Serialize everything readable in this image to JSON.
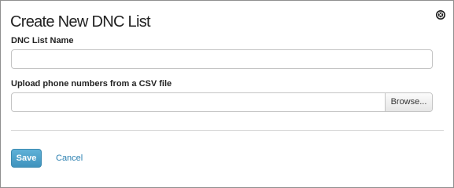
{
  "dialog": {
    "title": "Create New DNC List",
    "close_icon": "close-circle-icon"
  },
  "form": {
    "name_label": "DNC List Name",
    "name_value": "",
    "upload_label": "Upload phone numbers from a CSV file",
    "upload_value": "",
    "browse_label": "Browse..."
  },
  "actions": {
    "save_label": "Save",
    "cancel_label": "Cancel"
  },
  "colors": {
    "primary_button": "#4aa3cc",
    "link": "#2a7fb0"
  }
}
